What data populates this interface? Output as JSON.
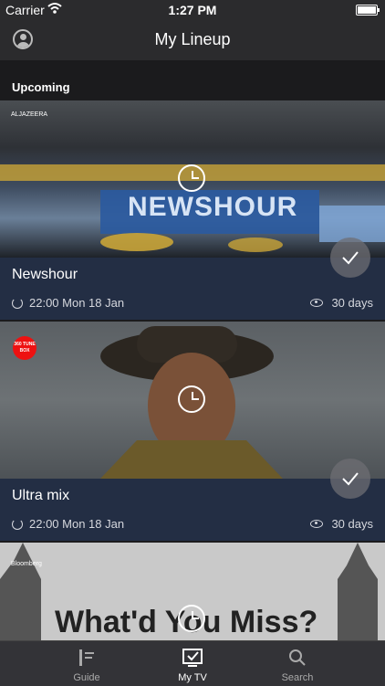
{
  "status_bar": {
    "carrier": "Carrier",
    "time": "1:27 PM"
  },
  "nav": {
    "title": "My Lineup"
  },
  "section": {
    "title": "Upcoming"
  },
  "cards": [
    {
      "title": "Newshour",
      "time": "22:00 Mon 18 Jan",
      "availability": "30 days",
      "image_text": "NEWSHOUR",
      "logo_text": "ALJAZEERA"
    },
    {
      "title": "Ultra mix",
      "time": "22:00 Mon 18 Jan",
      "availability": "30 days",
      "logo_text": "360 TUNE BOX"
    },
    {
      "image_text": "What'd You Miss?",
      "logo_text": "Bloomberg"
    }
  ],
  "tabs": [
    {
      "label": "Guide",
      "icon": "guide-icon"
    },
    {
      "label": "My TV",
      "icon": "my-tv-icon"
    },
    {
      "label": "Search",
      "icon": "search-icon"
    }
  ],
  "colors": {
    "accent": "#ffffff",
    "info_bg": "#232e44",
    "background": "#1b1b1d"
  }
}
